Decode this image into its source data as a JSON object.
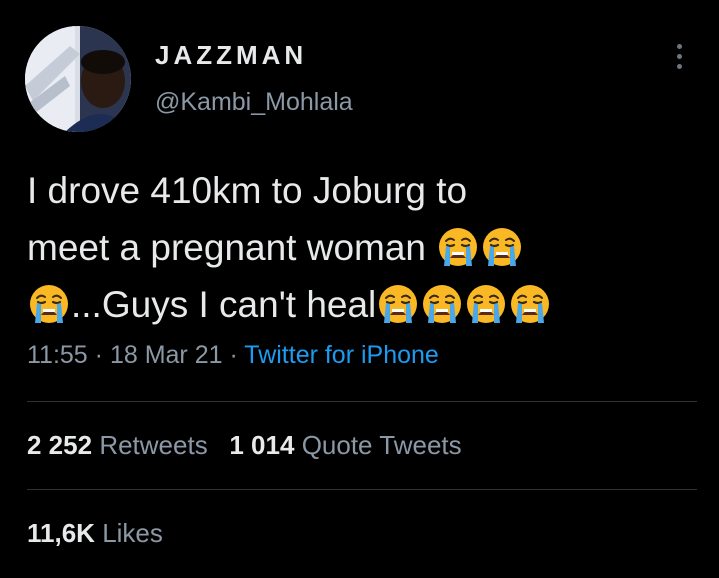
{
  "user": {
    "display_name": "JAZZMAN",
    "handle": "@Kambi_Mohlala",
    "avatar_icon": "profile-photo"
  },
  "tweet": {
    "lines": [
      "I drove 410km to Joburg to",
      "meet a pregnant woman ",
      "...Guys I can't heal"
    ],
    "emoji_icon": "loudly-crying-face",
    "time": "11:55",
    "date": "18 Mar 21",
    "separator": "·",
    "source": "Twitter for iPhone"
  },
  "stats": {
    "retweets_count": "2 252",
    "retweets_label": "Retweets",
    "quotes_count": "1 014",
    "quotes_label": "Quote Tweets",
    "likes_count": "11,6K",
    "likes_label": "Likes"
  },
  "colors": {
    "background": "#000000",
    "text": "#e7e9ea",
    "secondary": "#8b98a5",
    "link": "#1d9bf0",
    "divider": "#2f3336"
  }
}
